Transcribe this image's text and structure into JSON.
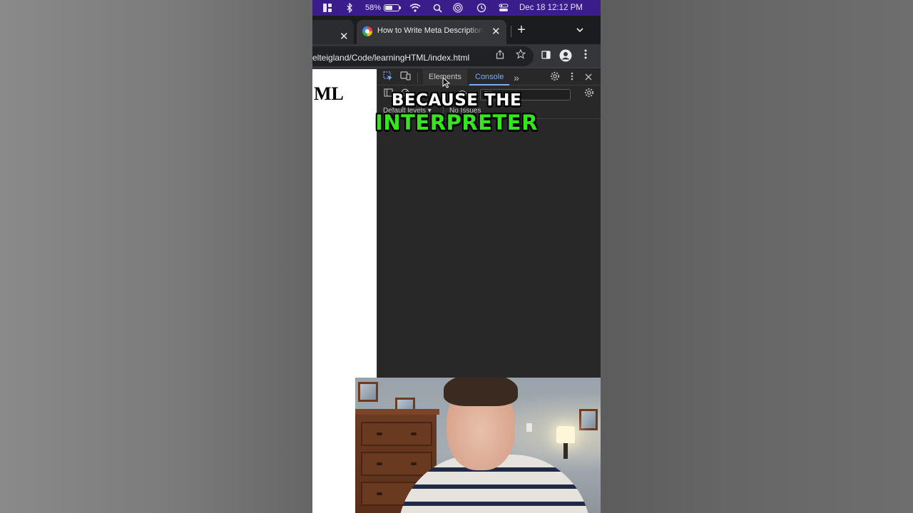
{
  "menubar": {
    "battery_percent": "58%",
    "datetime": "Dec 18  12:12 PM",
    "icons": [
      "window-layout-icon",
      "bluetooth-icon",
      "battery-icon",
      "wifi-icon",
      "spotlight-search-icon",
      "airdrop-icon",
      "time-machine-icon",
      "control-center-icon"
    ]
  },
  "browser": {
    "tabs": [
      {
        "title": "",
        "close_glyph": "✕"
      },
      {
        "title": "How to Write Meta Description",
        "close_glyph": "✕"
      }
    ],
    "new_tab_glyph": "+",
    "tab_search_glyph": "⌄",
    "url": "elteigland/Code/learningHTML/index.html"
  },
  "page": {
    "heading_fragment": "ML"
  },
  "devtools": {
    "tabs": [
      {
        "label": "Elements"
      },
      {
        "label": "Console"
      }
    ],
    "active_tab": "Console",
    "more_tabs_glyph": "»",
    "filter_placeholder": "Filter",
    "levels_label": "Default levels ▾",
    "issues_label": "No Issues"
  },
  "captions": {
    "line1": "BECAUSE THE",
    "line2": "INTERPRETER"
  },
  "colors": {
    "menubar_bg": "#3a1d8a",
    "caption_highlight": "#35e61f",
    "devtools_accent": "#7cacf8"
  }
}
